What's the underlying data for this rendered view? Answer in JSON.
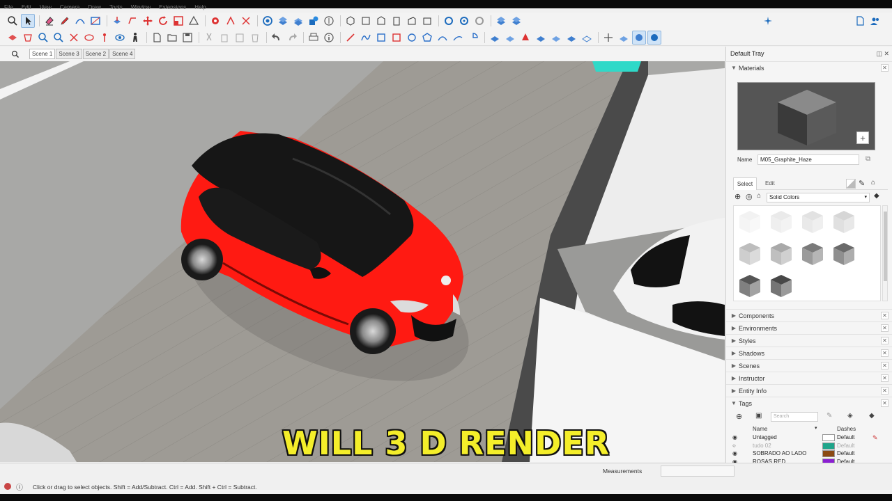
{
  "menu": [
    "File",
    "Edit",
    "View",
    "Camera",
    "Draw",
    "Tools",
    "Window",
    "Extensions",
    "Help"
  ],
  "scenes": {
    "tabs": [
      "Scene 1",
      "Scene 3",
      "Scene 2",
      "Scene 4"
    ],
    "selected": "Scene 1"
  },
  "caption": "WILL 3 D RENDER",
  "tray": {
    "title": "Default Tray",
    "materials": {
      "title": "Materials",
      "name_label": "Name",
      "name_value": "M05_Graphite_Haze",
      "tab_select": "Select",
      "tab_edit": "Edit",
      "library": "Solid Colors",
      "swatch_colors": [
        "#f2f2f2",
        "#eaeaea",
        "#e2e2e2",
        "#d6d6d6",
        "#bdbdbd",
        "#a9a9a9",
        "#7a7a7a",
        "#6a6a6a",
        "#555555",
        "#474747"
      ]
    },
    "sections": [
      "Components",
      "Environments",
      "Styles",
      "Shadows",
      "Scenes",
      "Instructor",
      "Entity Info",
      "Tags"
    ],
    "tags": {
      "search_placeholder": "Search",
      "col_name": "Name",
      "col_dashes": "Dashes",
      "rows": [
        {
          "name": "Untagged",
          "dash": "Default",
          "color": "#ffffff",
          "visible": true
        },
        {
          "name": "tudo 02",
          "dash": "Default",
          "color": "#1fa58a",
          "visible": false
        },
        {
          "name": "SOBRADO AO LADO",
          "dash": "Default",
          "color": "#8b4a12",
          "visible": true
        },
        {
          "name": "ROSAS RED",
          "dash": "Default",
          "color": "#8a1fd1",
          "visible": true
        }
      ]
    }
  },
  "status": {
    "hint": "Click or drag to select objects. Shift = Add/Subtract. Ctrl = Add. Shift + Ctrl = Subtract.",
    "measurements_label": "Measurements"
  },
  "colors": {
    "car_body": "#ff1a12",
    "roof": "#151515",
    "floor": "#9c9a94",
    "caption": "#f4ee2a"
  }
}
